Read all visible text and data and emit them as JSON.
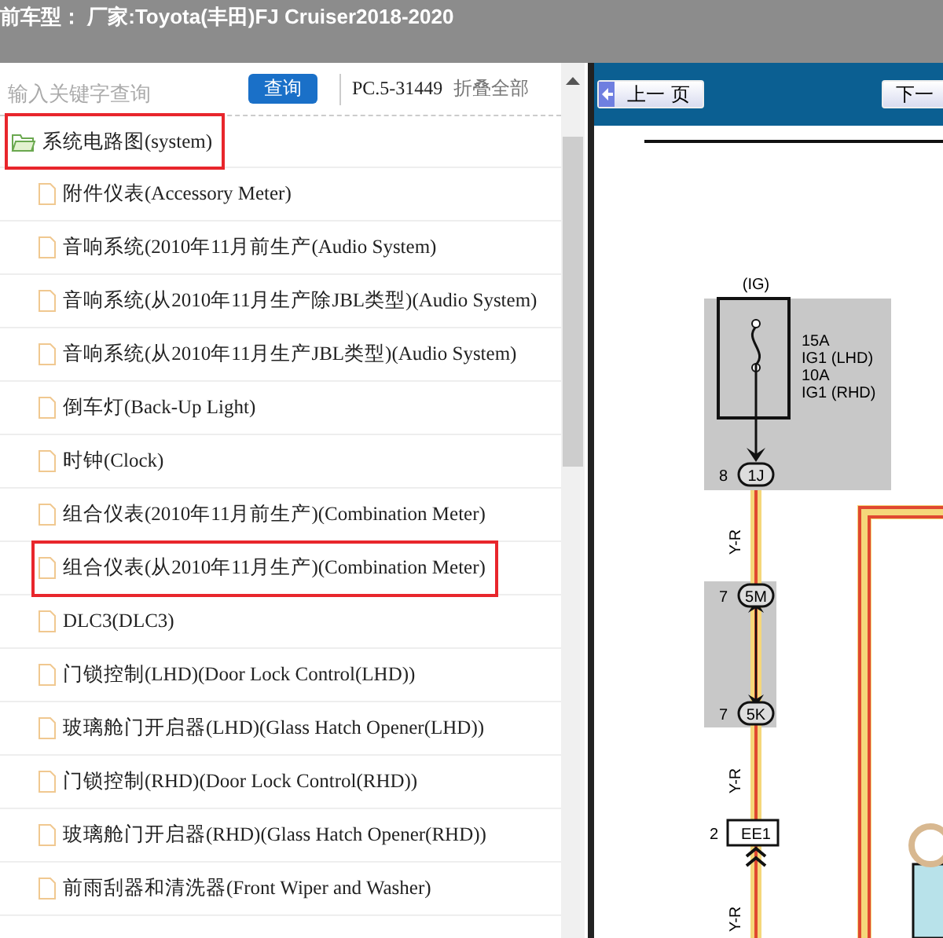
{
  "header": {
    "title": "前车型： 厂家:Toyota(丰田)FJ Cruiser2018-2020"
  },
  "search": {
    "placeholder": "输入关键字查询",
    "button": "查询"
  },
  "code": "PC.5-31449",
  "collapse_all": "折叠全部",
  "tree": [
    {
      "label": "系统电路图(system)",
      "expanded": true,
      "highlighted": true,
      "children": [
        {
          "label": "附件仪表(Accessory Meter)",
          "highlighted": false
        },
        {
          "label": "音响系统(2010年11月前生产(Audio System)",
          "highlighted": false
        },
        {
          "label": "音响系统(从2010年11月生产除JBL类型)(Audio System)",
          "highlighted": false
        },
        {
          "label": "音响系统(从2010年11月生产JBL类型)(Audio System)",
          "highlighted": false
        },
        {
          "label": "倒车灯(Back-Up Light)",
          "highlighted": false
        },
        {
          "label": "时钟(Clock)",
          "highlighted": false
        },
        {
          "label": "组合仪表(2010年11月前生产)(Combination Meter)",
          "highlighted": false
        },
        {
          "label": "组合仪表(从2010年11月生产)(Combination Meter)",
          "highlighted": true
        },
        {
          "label": "DLC3(DLC3)",
          "highlighted": false
        },
        {
          "label": "门锁控制(LHD)(Door Lock Control(LHD))",
          "highlighted": false
        },
        {
          "label": "玻璃舱门开启器(LHD)(Glass Hatch Opener(LHD))",
          "highlighted": false
        },
        {
          "label": "门锁控制(RHD)(Door Lock Control(RHD))",
          "highlighted": false
        },
        {
          "label": "玻璃舱门开启器(RHD)(Glass Hatch Opener(RHD))",
          "highlighted": false
        },
        {
          "label": "前雨刮器和清洗器(Front Wiper and Washer)",
          "highlighted": false
        }
      ]
    }
  ],
  "viewer": {
    "prev_button": "上一 页",
    "next_button": "下一",
    "diagram": {
      "supply": "(IG)",
      "fuse_ratings": [
        "15A",
        "IG1 (LHD)",
        "10A",
        "IG1 (RHD)"
      ],
      "connectors": [
        {
          "pin": "8",
          "id": "1J",
          "kind": "oval"
        },
        {
          "pin": "7",
          "id": "5M",
          "kind": "oval"
        },
        {
          "pin": "7",
          "id": "5K",
          "kind": "oval"
        },
        {
          "pin": "2",
          "id": "EE1",
          "kind": "box"
        }
      ],
      "wire_labels": [
        "Y-R",
        "Y-R",
        "Y-R"
      ]
    }
  }
}
